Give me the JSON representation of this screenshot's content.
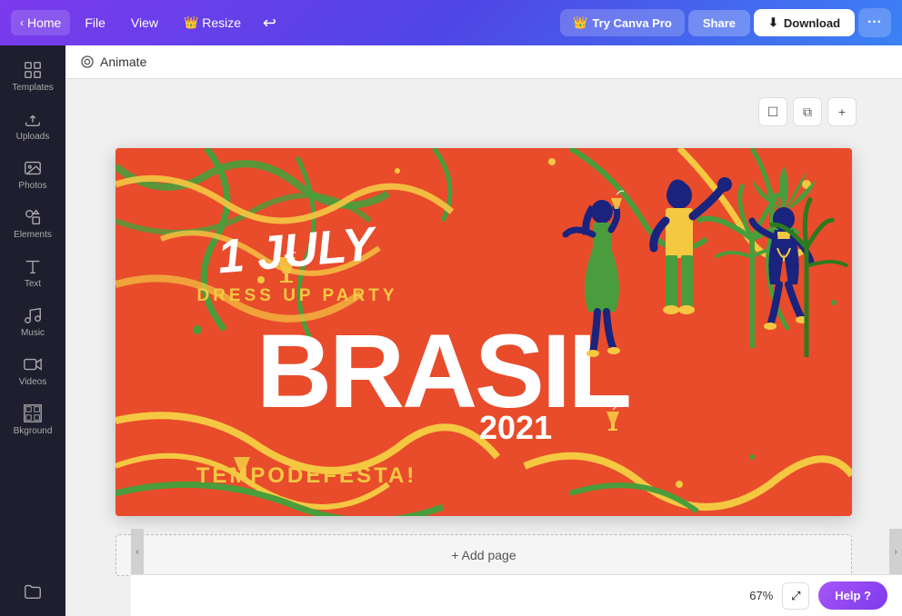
{
  "topnav": {
    "home_label": "Home",
    "file_label": "File",
    "view_label": "View",
    "resize_label": "Resize",
    "try_pro_label": "Try Canva Pro",
    "share_label": "Share",
    "download_label": "Download",
    "more_label": "···"
  },
  "sidebar": {
    "items": [
      {
        "id": "templates",
        "label": "Templates",
        "icon": "grid"
      },
      {
        "id": "uploads",
        "label": "Uploads",
        "icon": "upload"
      },
      {
        "id": "photos",
        "label": "Photos",
        "icon": "photo"
      },
      {
        "id": "elements",
        "label": "Elements",
        "icon": "elements"
      },
      {
        "id": "text",
        "label": "Text",
        "icon": "text"
      },
      {
        "id": "music",
        "label": "Music",
        "icon": "music"
      },
      {
        "id": "videos",
        "label": "Videos",
        "icon": "video"
      },
      {
        "id": "background",
        "label": "Bkground",
        "icon": "background"
      },
      {
        "id": "folder",
        "label": "",
        "icon": "folder"
      }
    ]
  },
  "animate_bar": {
    "animate_label": "Animate",
    "icon": "circle"
  },
  "canvas": {
    "design": {
      "date": "1 JULY",
      "subtitle": "DRESS UP PARTY",
      "main_title": "BRASIL",
      "year": "2021",
      "tagline": "TEMPODEFESTA!"
    },
    "add_page_label": "+ Add page"
  },
  "bottom_bar": {
    "zoom_level": "67%",
    "help_label": "Help ?",
    "fullscreen_icon": "⤢"
  }
}
